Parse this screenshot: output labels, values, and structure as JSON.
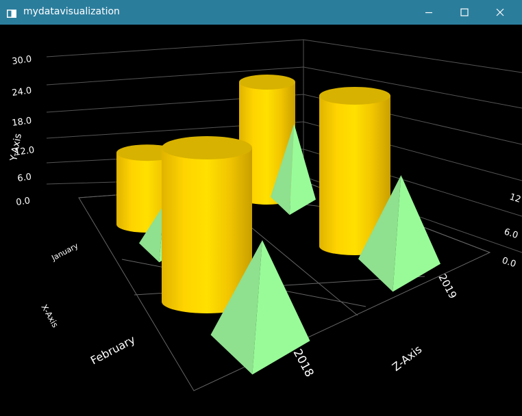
{
  "window": {
    "title": "mydatavisualization",
    "titlebar_color": "#2b7d9c",
    "icons": [
      "app-icon",
      "minimize-icon",
      "maximize-icon",
      "close-icon"
    ]
  },
  "chart_data": {
    "type": "bar",
    "style": "3d",
    "background": "#000000",
    "y_axis": {
      "label": "Y-Axis",
      "ticks": [
        "0.0",
        "6.0",
        "12.0",
        "18.0",
        "24.0",
        "30.0"
      ],
      "range": [
        0,
        30
      ]
    },
    "x_axis": {
      "label": "X-Axis",
      "categories": [
        "January",
        "February"
      ]
    },
    "z_axis": {
      "label": "Z-Axis",
      "categories": [
        "2018",
        "2019"
      ]
    },
    "right_wall_ticks": [
      "0.0",
      "6.0",
      "12"
    ],
    "series": [
      {
        "shape": "cylinder",
        "color": "#ffe000",
        "values": [
          {
            "x": "January",
            "z": "2018",
            "y": 24
          },
          {
            "x": "February",
            "z": "2018",
            "y": 30
          },
          {
            "x": "January",
            "z": "2019",
            "y": 30
          },
          {
            "x": "February",
            "z": "2019",
            "y": 30
          }
        ]
      },
      {
        "shape": "pyramid",
        "color": "#98fb98",
        "values": [
          {
            "x": "January",
            "z": "2018",
            "y": 6
          },
          {
            "x": "February",
            "z": "2018",
            "y": 12
          },
          {
            "x": "January",
            "z": "2019",
            "y": 12
          },
          {
            "x": "February",
            "z": "2019",
            "y": 12
          }
        ]
      }
    ]
  }
}
